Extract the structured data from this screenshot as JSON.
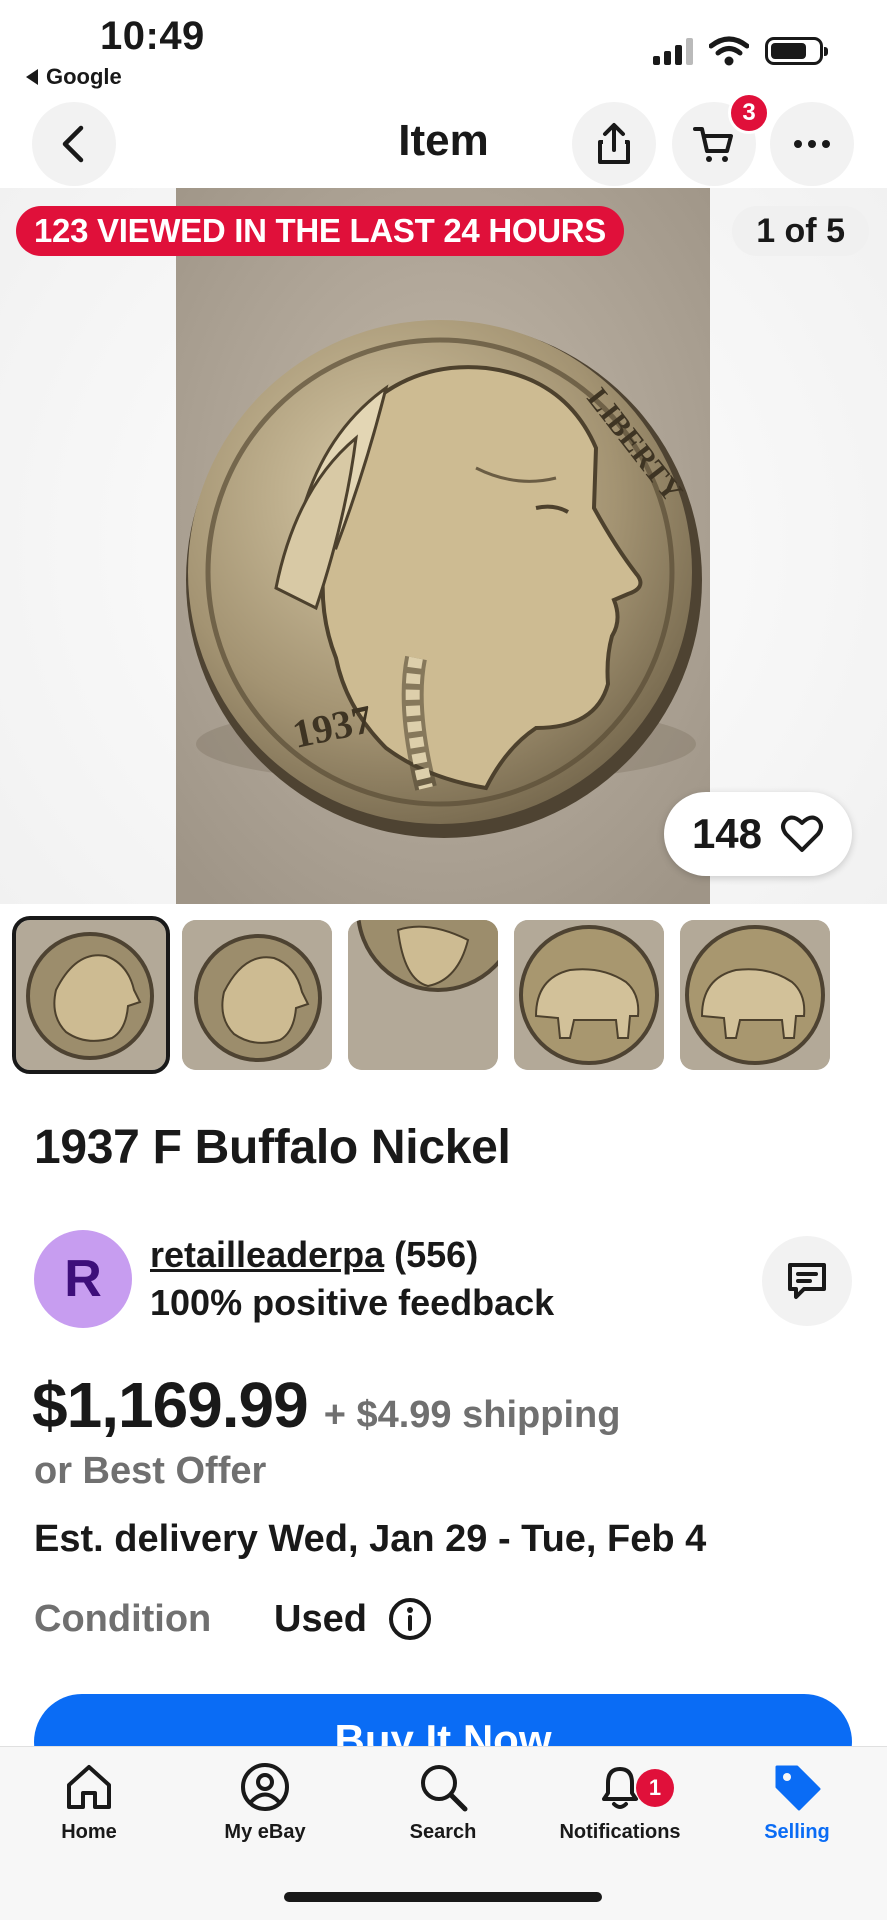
{
  "status_bar": {
    "time": "10:49",
    "back_app": "Google"
  },
  "header": {
    "title": "Item",
    "cart_count": "3"
  },
  "gallery": {
    "viewed_badge": "123 VIEWED IN THE LAST 24 HOURS",
    "image_counter": "1 of 5",
    "watch_count": "148",
    "coin_year": "1937",
    "coin_word": "LIBERTY",
    "thumbnails": [
      {
        "side": "obverse",
        "selected": true
      },
      {
        "side": "obverse",
        "selected": false
      },
      {
        "side": "obverse-detail",
        "selected": false
      },
      {
        "side": "reverse",
        "selected": false
      },
      {
        "side": "reverse",
        "selected": false
      }
    ]
  },
  "listing": {
    "title": "1937 F Buffalo Nickel",
    "seller": {
      "initial": "R",
      "name": "retailleaderpa",
      "feedback_count": "(556)",
      "feedback_percent": "100% positive feedback"
    },
    "price": "$1,169.99",
    "shipping": "+ $4.99 shipping",
    "best_offer": "or Best Offer",
    "delivery": "Est. delivery Wed, Jan 29 - Tue, Feb 4",
    "condition_label": "Condition",
    "condition_value": "Used",
    "buy_button": "Buy It Now"
  },
  "tabbar": {
    "items": [
      {
        "label": "Home",
        "icon": "home-icon"
      },
      {
        "label": "My eBay",
        "icon": "profile-icon"
      },
      {
        "label": "Search",
        "icon": "search-icon"
      },
      {
        "label": "Notifications",
        "icon": "bell-icon",
        "badge": "1"
      },
      {
        "label": "Selling",
        "icon": "tag-icon",
        "active": true
      }
    ]
  },
  "colors": {
    "accent_blue": "#0a6cf5",
    "badge_red": "#e0103a",
    "muted_text": "#707070",
    "avatar_bg": "#c79df0"
  }
}
